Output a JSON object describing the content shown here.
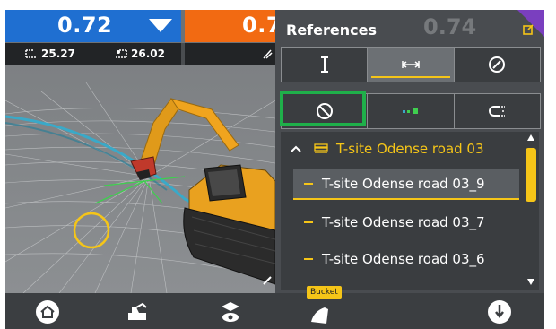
{
  "metrics": {
    "primary_value": "0.72",
    "secondary_value": "0.7",
    "ghost_value": "0.74",
    "left_sub_value": "25.27",
    "right_sub_value": "26.02"
  },
  "panel": {
    "title": "References",
    "mode_tabs": [
      "vertical-height-icon",
      "horizontal-width-icon",
      "compass-icon"
    ],
    "tool_tabs": [
      "no-entry-icon",
      "points-icon",
      "magnet-icon"
    ],
    "group": {
      "label": "T-site Odense road 03",
      "expanded": true
    },
    "items": [
      {
        "label": "T-site Odense road 03_9",
        "selected": true
      },
      {
        "label": "T-site Odense road 03_7",
        "selected": false
      },
      {
        "label": "T-site Odense road 03_6",
        "selected": false
      }
    ]
  },
  "tooltip": {
    "label": "Bucket"
  },
  "toolbar": {
    "buttons": [
      "home-icon",
      "machine-icon",
      "view-icon",
      "bucket-icon",
      "info-icon"
    ]
  },
  "colors": {
    "primary_bar": "#1f6fd1",
    "secondary_bar": "#f26a12",
    "accent": "#f5c518",
    "highlight": "#1fb04a",
    "corner": "#7a3fbf"
  }
}
